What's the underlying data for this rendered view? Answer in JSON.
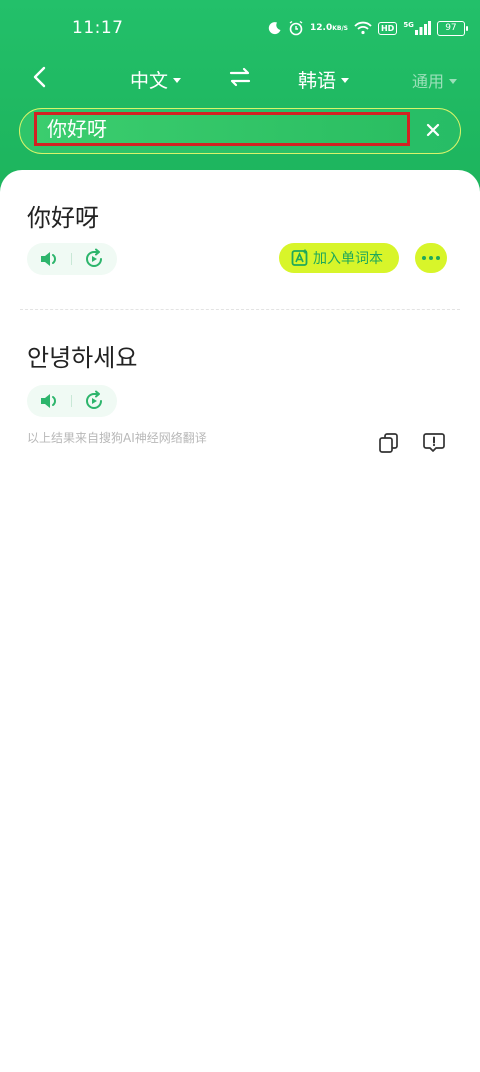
{
  "status_bar": {
    "time": "11:17",
    "net_speed_value": "12.0",
    "net_speed_unit": "KB/S",
    "hd": "HD",
    "network_type": "5G",
    "battery": "97"
  },
  "nav": {
    "source_lang": "中文",
    "target_lang": "韩语",
    "mode": "通用"
  },
  "search": {
    "value": "你好呀"
  },
  "result": {
    "source_text": "你好呀",
    "add_word_label": "加入单词本",
    "translation": "안녕하세요",
    "source_note": "以上结果来自搜狗AI神经网络翻译"
  },
  "colors": {
    "brand_green": "#1fb861",
    "accent_yellow": "#d8f52a",
    "highlight_red": "#d22222"
  }
}
